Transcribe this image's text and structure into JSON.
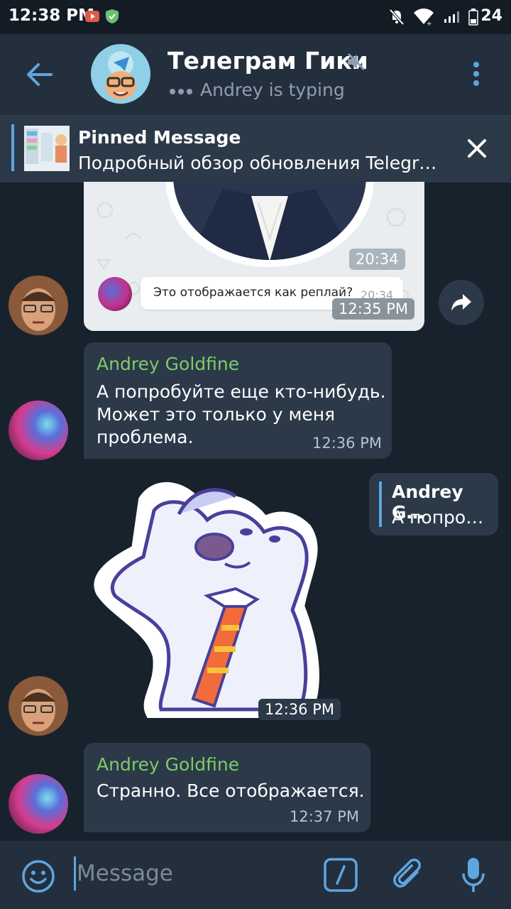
{
  "status_bar": {
    "time": "12:38 PM",
    "battery_level": "24",
    "icons": [
      "youtube-notification-icon",
      "shield-icon",
      "bell-muted-icon",
      "wifi-icon",
      "signal-icon",
      "battery-icon"
    ]
  },
  "header": {
    "title": "Телеграм Гики",
    "subtitle": "Andrey is typing",
    "muted": true
  },
  "pinned": {
    "label": "Pinned Message",
    "text": "Подробный обзор обновления Telegr…"
  },
  "messages": {
    "m1": {
      "inner_time": "20:34",
      "reply_text": "Это отображается как реплай?",
      "reply_time": "20:34",
      "time": "12:35 PM"
    },
    "m2": {
      "sender": "Andrey Goldfine",
      "text_lines": [
        "А попробуйте еще кто-нибудь.",
        "Может это только у меня",
        "проблема."
      ],
      "time": "12:36 PM"
    },
    "m3": {
      "reply_sender": "Andrey G…",
      "reply_text": "А попро…"
    },
    "m4": {
      "time": "12:36 PM"
    },
    "m5": {
      "sender": "Andrey Goldfine",
      "text": "Странно. Все отображается.",
      "time": "12:37 PM"
    }
  },
  "input": {
    "placeholder": "Message"
  },
  "colors": {
    "background": "#18222d",
    "header": "#242f3d",
    "bubble": "#2b3948",
    "accent": "#5ea6e0",
    "sender_name": "#7ecb6b"
  }
}
